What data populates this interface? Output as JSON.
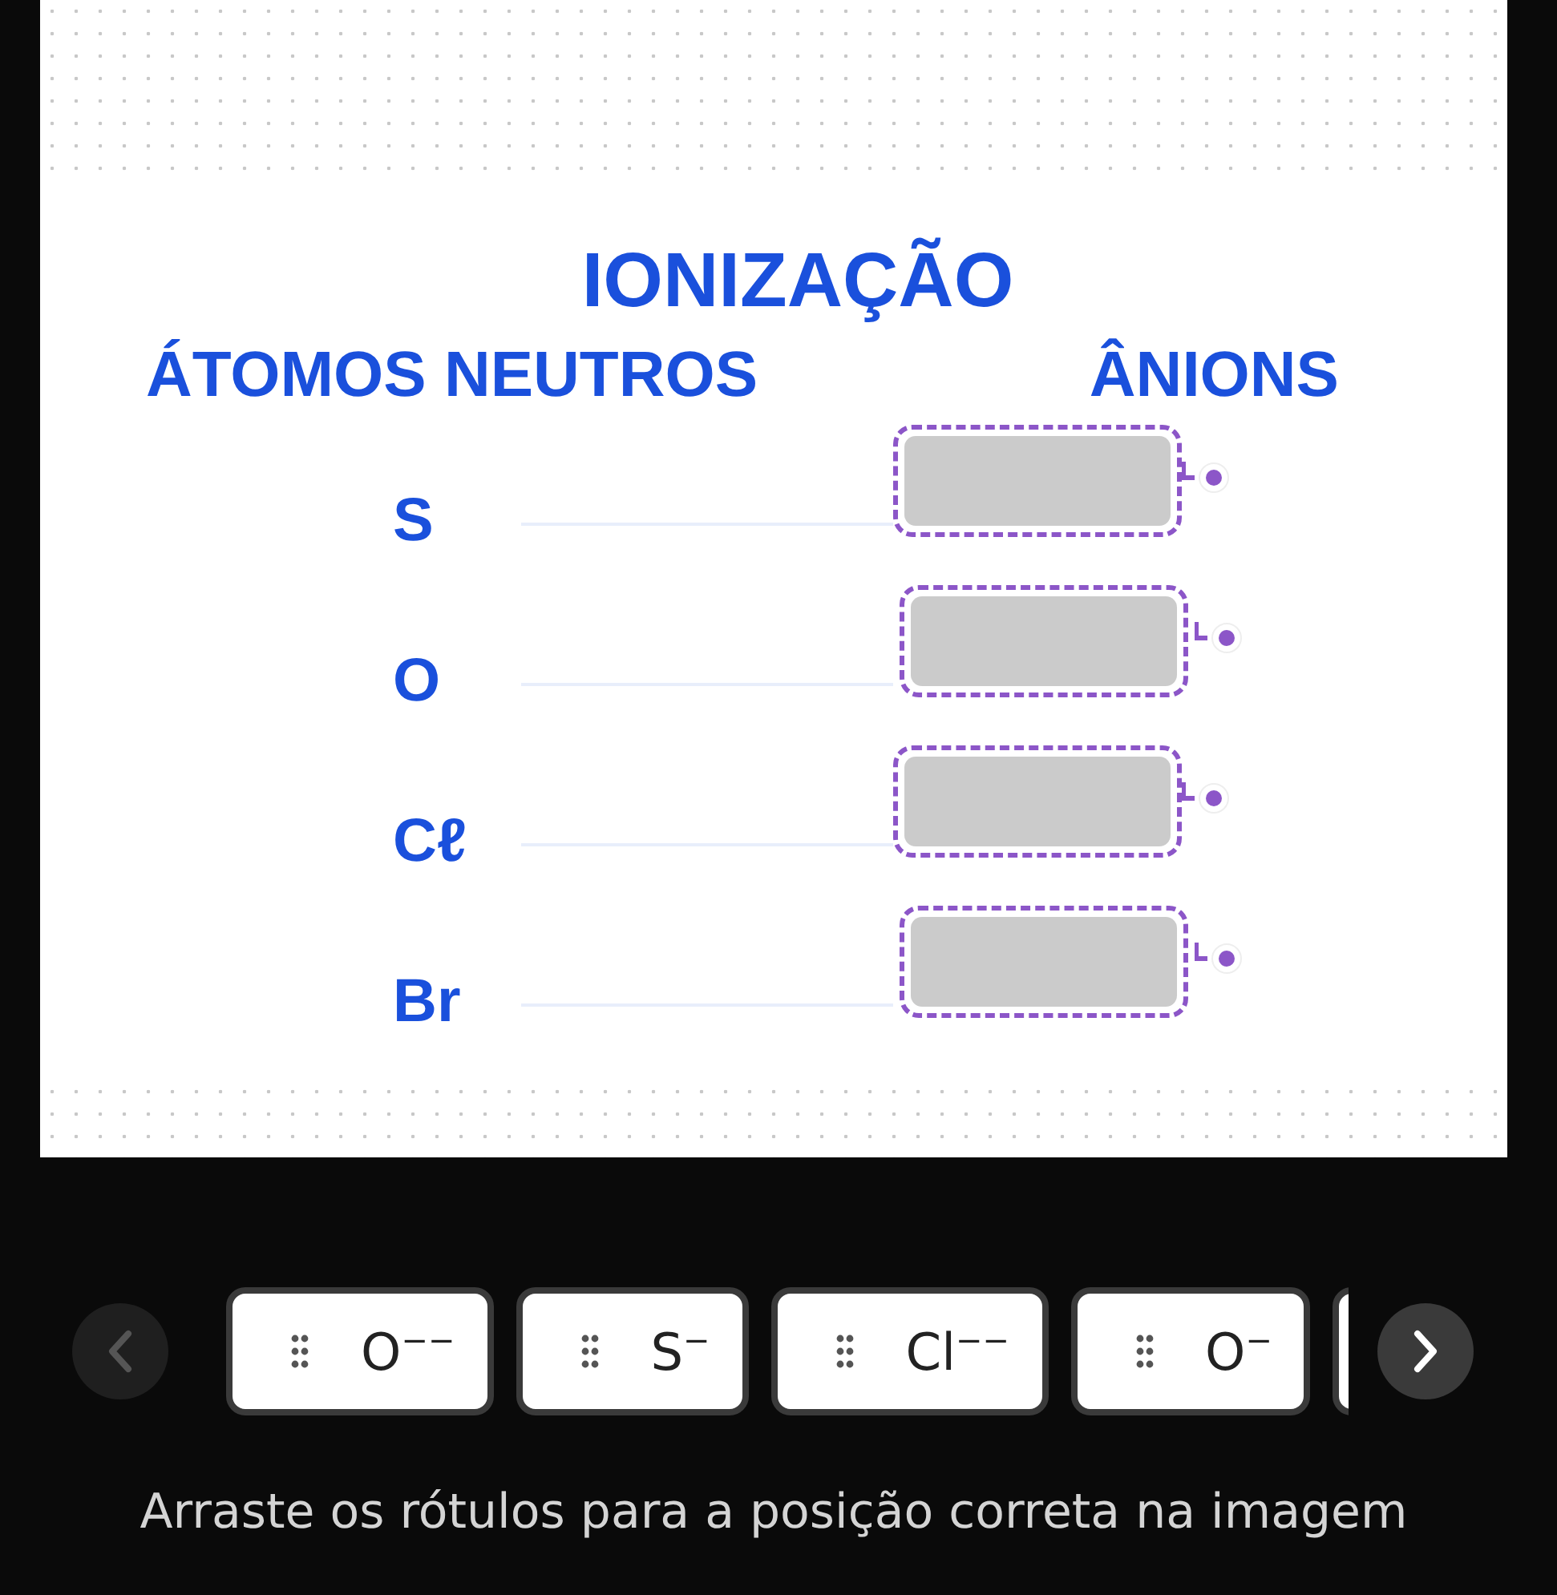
{
  "image": {
    "title": "IONIZAÇÃO",
    "left_heading": "ÁTOMOS NEUTROS",
    "right_heading": "ÂNIONS",
    "rows": [
      {
        "symbol": "S"
      },
      {
        "symbol": "O"
      },
      {
        "symbol": "Cℓ"
      },
      {
        "symbol": "Br"
      }
    ]
  },
  "labels": [
    {
      "text": "O$^{−−}$"
    },
    {
      "text": "S$^{−}$"
    },
    {
      "text": "Cl$^{−−}$"
    },
    {
      "text": "O$^{−}$"
    }
  ],
  "instruction": "Arraste os rótulos para a posição correta na imagem"
}
